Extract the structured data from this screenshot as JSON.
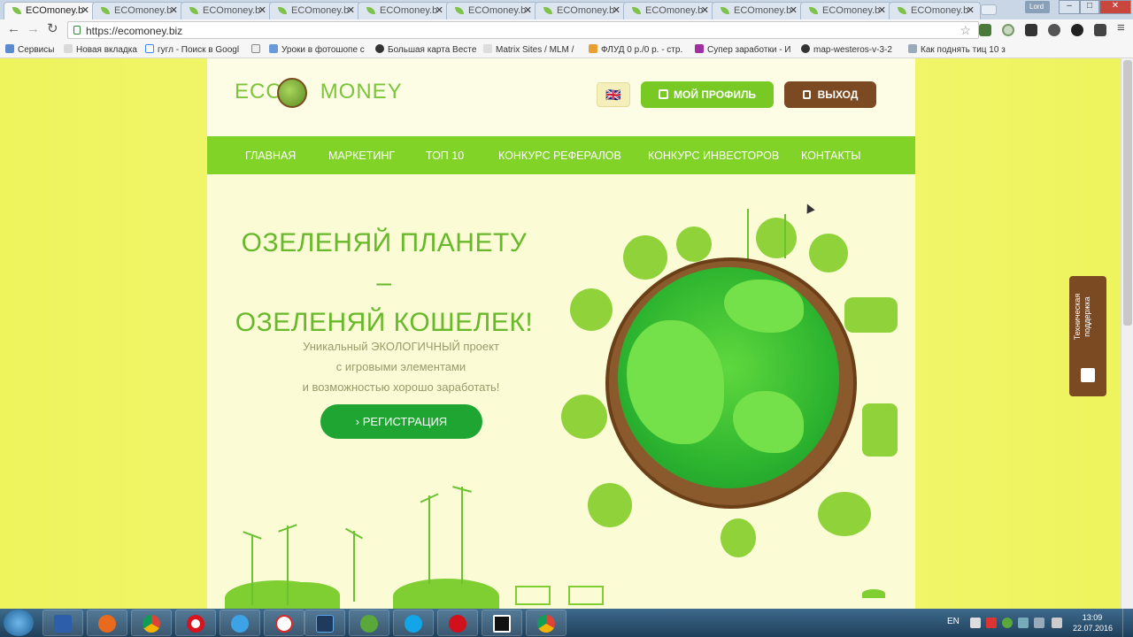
{
  "browser": {
    "tabs": [
      {
        "label": "ECOmoney.b",
        "active": true
      },
      {
        "label": "ECOmoney.b"
      },
      {
        "label": "ECOmoney.b"
      },
      {
        "label": "ECOmoney.b"
      },
      {
        "label": "ECOmoney.b"
      },
      {
        "label": "ECOmoney.b"
      },
      {
        "label": "ECOmoney.b"
      },
      {
        "label": "ECOmoney.b"
      },
      {
        "label": "ECOmoney.b"
      },
      {
        "label": "ECOmoney.b"
      },
      {
        "label": "ECOmoney.b"
      }
    ],
    "user_badge": "Lord",
    "url": "https://ecomoney.biz",
    "bookmarks": [
      "Сервисы",
      "Новая вкладка",
      "гугл - Поиск в Googl",
      "Уроки в фотошопе с",
      "Большая карта Вестe",
      "Matrix Sites / MLM /",
      "ФЛУД 0 р./0 р. - стр.",
      "Супер заработки - И",
      "map-westeros-v-3-2",
      "Как поднять тиц 10 з"
    ]
  },
  "site": {
    "logo_left": "ECO",
    "logo_right": "MONEY",
    "lang_flag": "🇬🇧",
    "profile_button": "МОЙ ПРОФИЛЬ",
    "logout_button": "ВЫХОД",
    "menu": [
      "ГЛАВНАЯ",
      "МАРКЕТИНГ",
      "ТОП 10",
      "КОНКУРС РЕФЕРАЛОВ",
      "КОНКУРС ИНВЕСТОРОВ",
      "КОНТАКТЫ"
    ],
    "hero_title_line1": "ОЗЕЛЕНЯЙ ПЛАНЕТУ –",
    "hero_title_line2": "ОЗЕЛЕНЯЙ КОШЕЛЕК!",
    "hero_sub_line1": "Уникальный ЭКОЛОГИЧНЫЙ проект",
    "hero_sub_line2": "с игровыми элементами",
    "hero_sub_line3": "и возможностью хорошо заработать!",
    "register_button": "›  РЕГИСТРАЦИЯ",
    "support_tab": "Техническая поддержка"
  },
  "taskbar": {
    "lang": "EN",
    "time": "13:09",
    "date": "22.07.2016"
  },
  "colors": {
    "menu_green": "#82d327",
    "button_green": "#78c924",
    "register_green": "#1fa632",
    "brown": "#7b4a22",
    "page_bg": "#eef45c"
  }
}
